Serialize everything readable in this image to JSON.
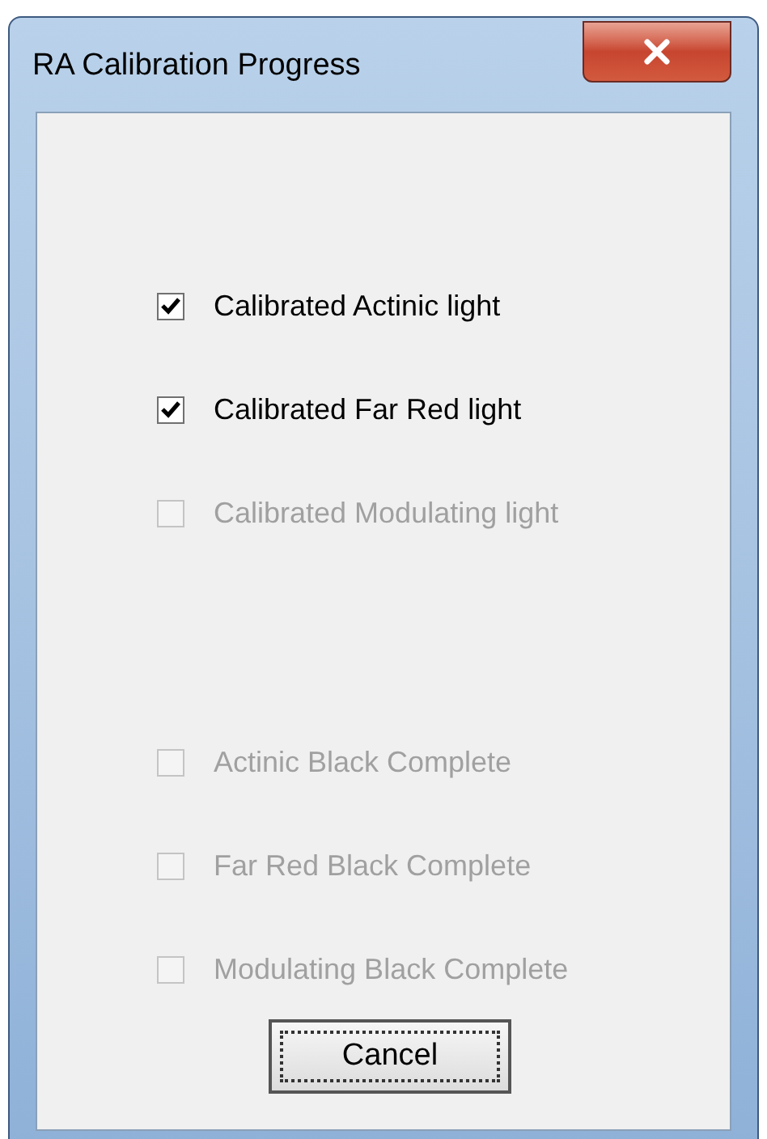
{
  "window": {
    "title": "RA Calibration Progress"
  },
  "groups": [
    {
      "items": [
        {
          "label": "Calibrated Actinic light",
          "checked": true,
          "disabled": false
        },
        {
          "label": "Calibrated Far Red light",
          "checked": true,
          "disabled": false
        },
        {
          "label": "Calibrated Modulating light",
          "checked": false,
          "disabled": true
        }
      ]
    },
    {
      "items": [
        {
          "label": "Actinic Black Complete",
          "checked": false,
          "disabled": true
        },
        {
          "label": "Far Red Black Complete",
          "checked": false,
          "disabled": true
        },
        {
          "label": "Modulating Black Complete",
          "checked": false,
          "disabled": true
        }
      ]
    }
  ],
  "buttons": [
    {
      "label": "Cancel",
      "focused": true
    }
  ]
}
